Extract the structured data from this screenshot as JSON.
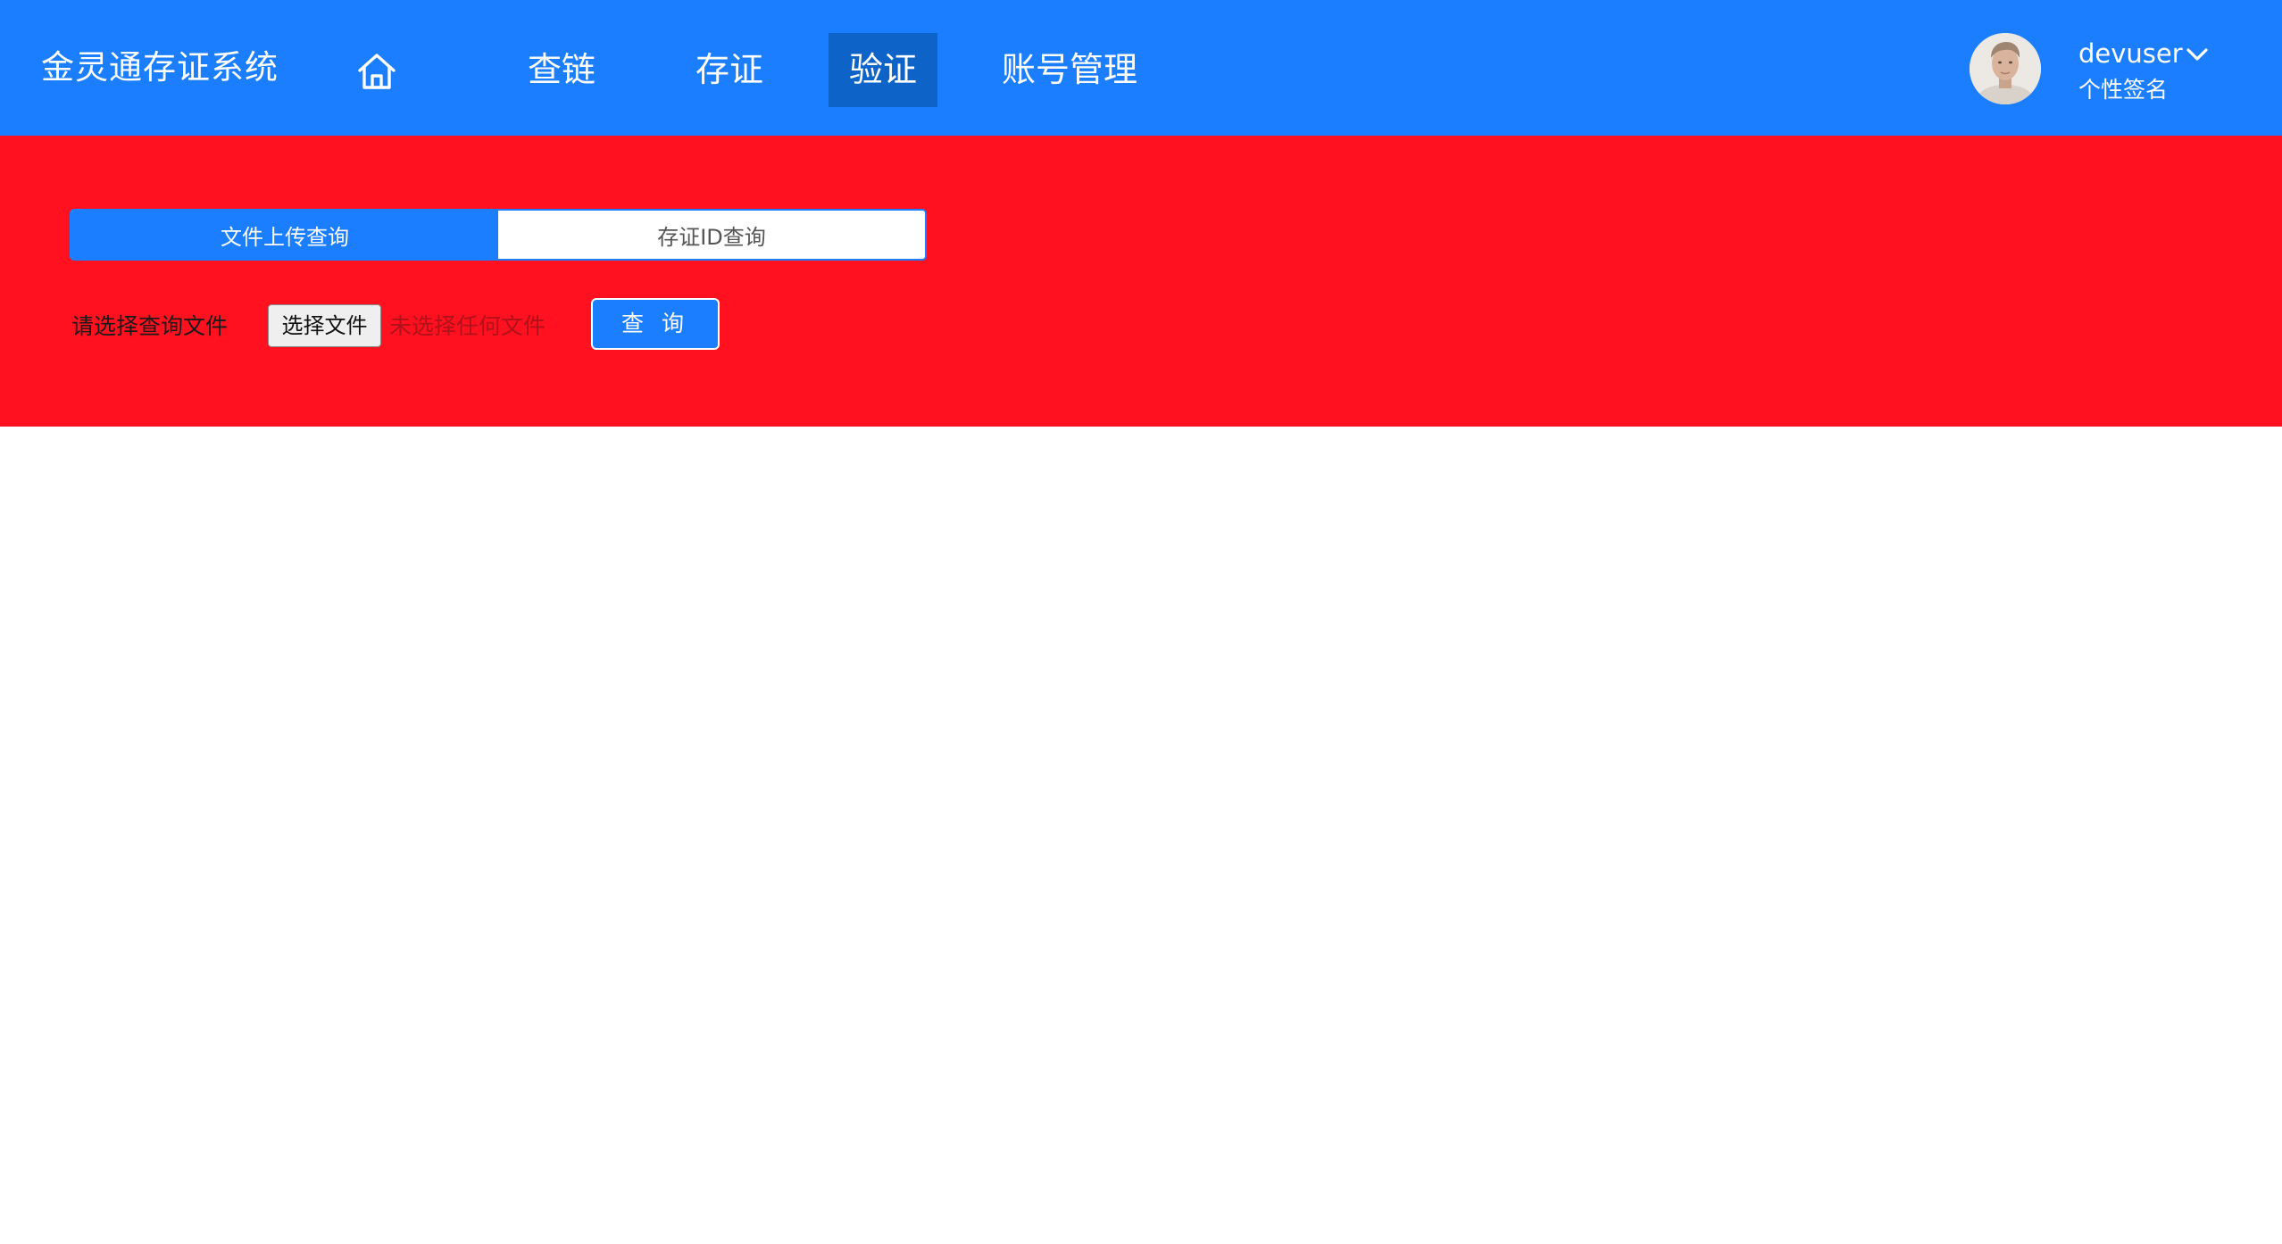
{
  "colors": {
    "header_bg": "#1a7eff",
    "nav_active_bg": "#0e63c9",
    "panel_bg": "#ff111f",
    "primary": "#1a7eff",
    "file_status_text": "#b0111a"
  },
  "header": {
    "brand": "金灵通存证系统",
    "home_icon": "home-icon",
    "nav": [
      {
        "label": "查链",
        "active": false
      },
      {
        "label": "存证",
        "active": false
      },
      {
        "label": "验证",
        "active": true
      },
      {
        "label": "账号管理",
        "active": false
      }
    ],
    "user": {
      "avatar_icon": "user-avatar",
      "name": "devuser",
      "dropdown_icon": "chevron-down-icon",
      "signature": "个性签名"
    }
  },
  "verify": {
    "tabs": [
      {
        "label": "文件上传查询",
        "active": true
      },
      {
        "label": "存证ID查询",
        "active": false
      }
    ],
    "file_label": "请选择查询文件",
    "choose_file_button": "选择文件",
    "file_status": "未选择任何文件",
    "query_button": "查 询"
  }
}
